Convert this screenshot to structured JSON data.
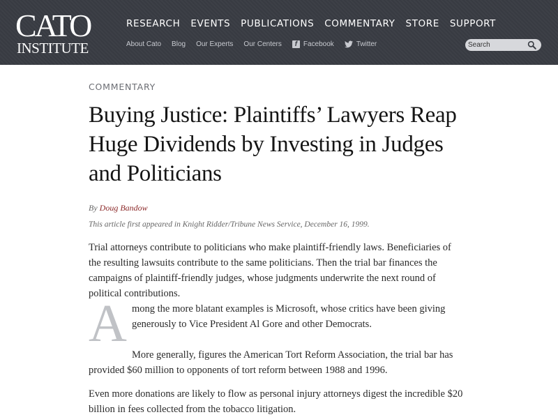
{
  "header": {
    "logo": {
      "line1": "CATO",
      "line2": "INSTITUTE"
    },
    "main_nav": [
      "RESEARCH",
      "EVENTS",
      "PUBLICATIONS",
      "COMMENTARY",
      "STORE",
      "SUPPORT"
    ],
    "sub_nav": {
      "about": "About Cato",
      "blog": "Blog",
      "experts": "Our Experts",
      "centers": "Our Centers",
      "facebook": "Facebook",
      "twitter": "Twitter"
    },
    "search": {
      "placeholder": "Search"
    }
  },
  "article": {
    "kicker": "COMMENTARY",
    "title": "Buying Justice: Plaintiffs’ Lawyers Reap Huge Dividends by Investing in Judges and Politicians",
    "byline_prefix": "By ",
    "author": "Doug Bandow",
    "source": "This article first appeared in Knight Ridder/Tribune News Service, December 16, 1999.",
    "paragraphs": {
      "p1": "Trial attorneys contribute to politicians who make plaintiff-friendly laws. Beneficiaries of the resulting lawsuits contribute to the same politicians. Then the trial bar finances the campaigns of plaintiff-friendly judges, whose judgments underwrite the next round of political contributions.",
      "dropcap": "A",
      "p2": "mong the more blatant examples is Microsoft, whose critics have been giving generously to Vice President Al Gore and other Democrats.",
      "p3": "More generally, figures the American Tort Reform Association, the trial bar has provided $60 million to opponents of tort reform between 1988 and 1996.",
      "p4": "Even more donations are likely to flow as personal injury attorneys digest the incredible $20 billion in fees collected from the tobacco litigation."
    }
  },
  "colors": {
    "header_bg": "#393c43",
    "author_link": "#8c2a2a",
    "kicker": "#6b6d73",
    "dropcap": "#c0c2c6"
  },
  "icons": [
    "facebook-icon",
    "twitter-icon",
    "search-icon"
  ]
}
